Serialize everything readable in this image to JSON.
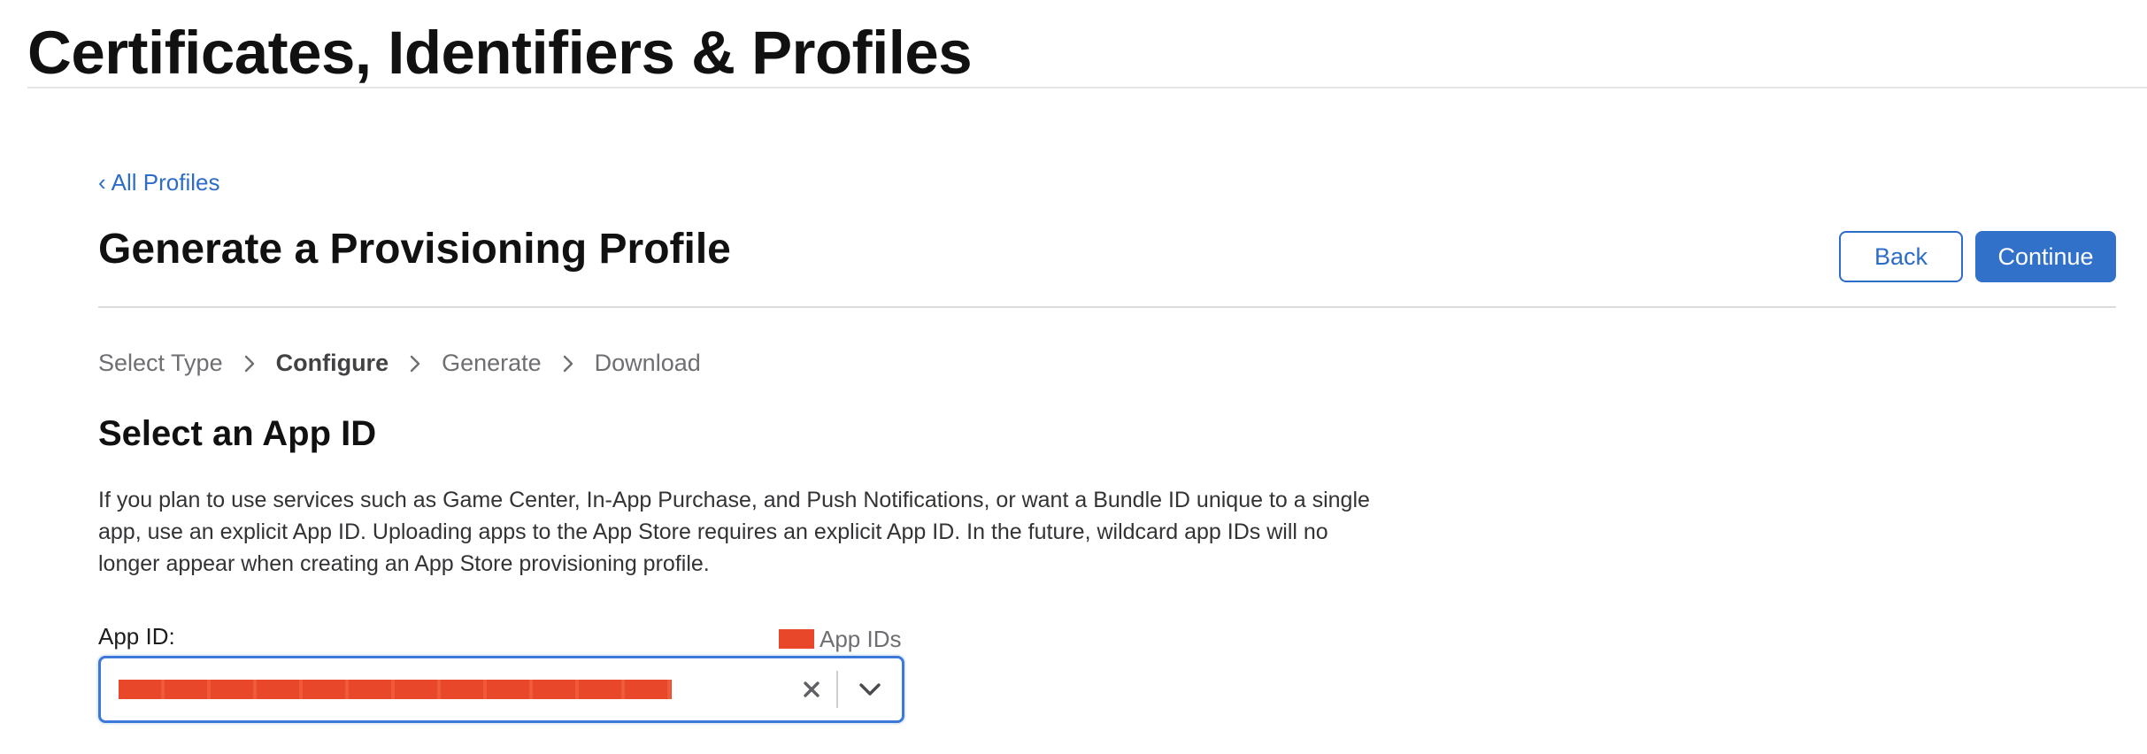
{
  "header": {
    "title": "Certificates, Identifiers & Profiles"
  },
  "nav": {
    "back_link": {
      "label": "All Profiles",
      "chevron": "‹"
    }
  },
  "page": {
    "title": "Generate a Provisioning Profile",
    "buttons": {
      "back": "Back",
      "continue": "Continue"
    }
  },
  "steps": [
    {
      "label": "Select Type",
      "current": false
    },
    {
      "label": "Configure",
      "current": true
    },
    {
      "label": "Generate",
      "current": false
    },
    {
      "label": "Download",
      "current": false
    }
  ],
  "section": {
    "title": "Select an App ID",
    "description": "If you plan to use services such as Game Center, In-App Purchase, and Push Notifications, or want a Bundle ID unique to a single app, use an explicit App ID. Uploading apps to the App Store requires an explicit App ID. In the future, wildcard app IDs will no longer appear when creating an App Store provisioning profile."
  },
  "app_id_field": {
    "label": "App ID:",
    "count_suffix": "App IDs",
    "selected_value": "",
    "clear_icon": "close-icon",
    "dropdown_icon": "chevron-down-icon"
  },
  "colors": {
    "link": "#2d6cc8",
    "primary_button": "#3271c9",
    "focus_border": "#3b78d8",
    "redaction": "#e8472a"
  }
}
